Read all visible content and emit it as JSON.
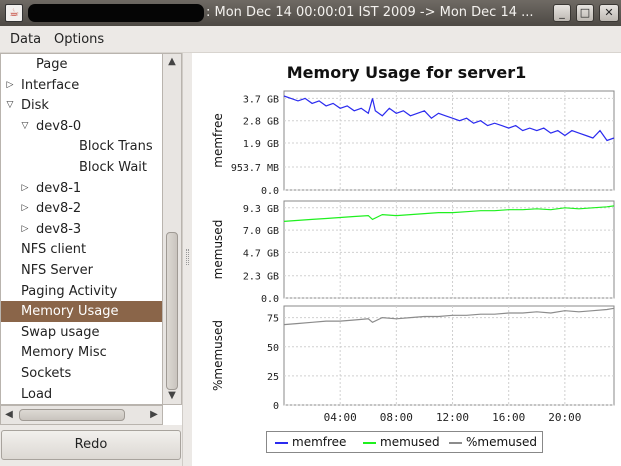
{
  "window": {
    "title": ": Mon Dec 14 00:00:01 IST 2009 -> Mon Dec 14 ...",
    "controls": {
      "minimize": "_",
      "maximize": "□",
      "close": "✕"
    }
  },
  "menubar": {
    "items": [
      "Data",
      "Options"
    ]
  },
  "tree": {
    "items": [
      {
        "label": "Page",
        "level": 1,
        "toggle": ""
      },
      {
        "label": "Interface",
        "level": 0,
        "toggle": "collapsed"
      },
      {
        "label": "Disk",
        "level": 0,
        "toggle": "expanded"
      },
      {
        "label": "dev8-0",
        "level": 1,
        "toggle": "expanded"
      },
      {
        "label": "Block Trans",
        "level": 2,
        "toggle": ""
      },
      {
        "label": "Block Wait",
        "level": 2,
        "toggle": ""
      },
      {
        "label": "dev8-1",
        "level": 1,
        "toggle": "collapsed"
      },
      {
        "label": "dev8-2",
        "level": 1,
        "toggle": "collapsed"
      },
      {
        "label": "dev8-3",
        "level": 1,
        "toggle": "collapsed"
      },
      {
        "label": "NFS client",
        "level": 0,
        "toggle": ""
      },
      {
        "label": "NFS Server",
        "level": 0,
        "toggle": ""
      },
      {
        "label": "Paging Activity",
        "level": 0,
        "toggle": ""
      },
      {
        "label": "Memory Usage",
        "level": 0,
        "toggle": "",
        "selected": true
      },
      {
        "label": "Swap usage",
        "level": 0,
        "toggle": ""
      },
      {
        "label": "Memory Misc",
        "level": 0,
        "toggle": ""
      },
      {
        "label": "Sockets",
        "level": 0,
        "toggle": ""
      },
      {
        "label": "Load",
        "level": 0,
        "toggle": ""
      }
    ]
  },
  "buttons": {
    "redo": "Redo"
  },
  "colors": {
    "memfree": "#2b2bef",
    "memused": "#1ff01f",
    "pctmemused": "#8c8c8c",
    "selection": "#8a6549"
  },
  "chart_data": {
    "type": "line",
    "title": "Memory Usage for server1",
    "x_ticks": [
      "04:00",
      "08:00",
      "12:00",
      "16:00",
      "20:00"
    ],
    "x_range_hours": [
      0,
      23.5
    ],
    "legend": [
      "memfree",
      "memused",
      "%memused"
    ],
    "legend_position": "bottom-center",
    "grid": true,
    "subplots": [
      {
        "ylabel": "memfree",
        "y_ticks": [
          "3.7 GB",
          "2.8 GB",
          "1.9 GB",
          "953.7 MB",
          "0.0"
        ],
        "y_tick_values": [
          3.7,
          2.8,
          1.9,
          0.93,
          0.0
        ],
        "ylim": [
          0,
          4.0
        ],
        "series": {
          "name": "memfree",
          "x": [
            0,
            0.5,
            1,
            1.5,
            2,
            2.5,
            3,
            3.5,
            4,
            4.5,
            5,
            5.5,
            6,
            6.3,
            6.5,
            7,
            7.5,
            8,
            8.5,
            9,
            9.5,
            10,
            10.5,
            11,
            11.5,
            12,
            12.5,
            13,
            13.5,
            14,
            14.5,
            15,
            15.5,
            16,
            16.5,
            17,
            17.5,
            18,
            18.5,
            19,
            19.5,
            20,
            20.5,
            21,
            21.5,
            22,
            22.5,
            23,
            23.5
          ],
          "y": [
            3.8,
            3.7,
            3.6,
            3.7,
            3.5,
            3.6,
            3.4,
            3.5,
            3.3,
            3.4,
            3.2,
            3.3,
            3.1,
            3.7,
            3.2,
            3.0,
            3.3,
            3.1,
            3.2,
            3.0,
            3.1,
            3.2,
            2.9,
            3.1,
            3.0,
            2.9,
            2.8,
            2.9,
            2.7,
            2.8,
            2.6,
            2.7,
            2.6,
            2.5,
            2.6,
            2.4,
            2.5,
            2.4,
            2.5,
            2.3,
            2.4,
            2.2,
            2.4,
            2.3,
            2.2,
            2.1,
            2.4,
            2.0,
            2.1
          ]
        }
      },
      {
        "ylabel": "memused",
        "y_ticks": [
          "9.3 GB",
          "7.0 GB",
          "4.7 GB",
          "2.3 GB",
          "0.0"
        ],
        "y_tick_values": [
          9.3,
          7.0,
          4.7,
          2.3,
          0.0
        ],
        "ylim": [
          0,
          10.0
        ],
        "series": {
          "name": "memused",
          "x": [
            0,
            1,
            2,
            3,
            4,
            5,
            6,
            6.3,
            7,
            8,
            9,
            10,
            11,
            12,
            13,
            14,
            15,
            16,
            17,
            18,
            19,
            20,
            21,
            22,
            23,
            23.5
          ],
          "y": [
            7.9,
            8.0,
            8.1,
            8.2,
            8.3,
            8.4,
            8.5,
            8.1,
            8.6,
            8.5,
            8.6,
            8.7,
            8.8,
            8.8,
            8.9,
            9.0,
            9.0,
            9.1,
            9.1,
            9.2,
            9.1,
            9.3,
            9.2,
            9.3,
            9.4,
            9.5
          ]
        }
      },
      {
        "ylabel": "%memused",
        "y_ticks": [
          "75",
          "50",
          "25",
          "0"
        ],
        "y_tick_values": [
          75,
          50,
          25,
          0
        ],
        "ylim": [
          0,
          85
        ],
        "series": {
          "name": "%memused",
          "x": [
            0,
            1,
            2,
            3,
            4,
            5,
            6,
            6.3,
            7,
            8,
            9,
            10,
            11,
            12,
            13,
            14,
            15,
            16,
            17,
            18,
            19,
            20,
            21,
            22,
            23,
            23.5
          ],
          "y": [
            69,
            70,
            71,
            72,
            72,
            73,
            74,
            71,
            75,
            74,
            75,
            76,
            76,
            77,
            77,
            78,
            78,
            79,
            79,
            80,
            79,
            81,
            80,
            81,
            82,
            83
          ]
        }
      }
    ]
  }
}
